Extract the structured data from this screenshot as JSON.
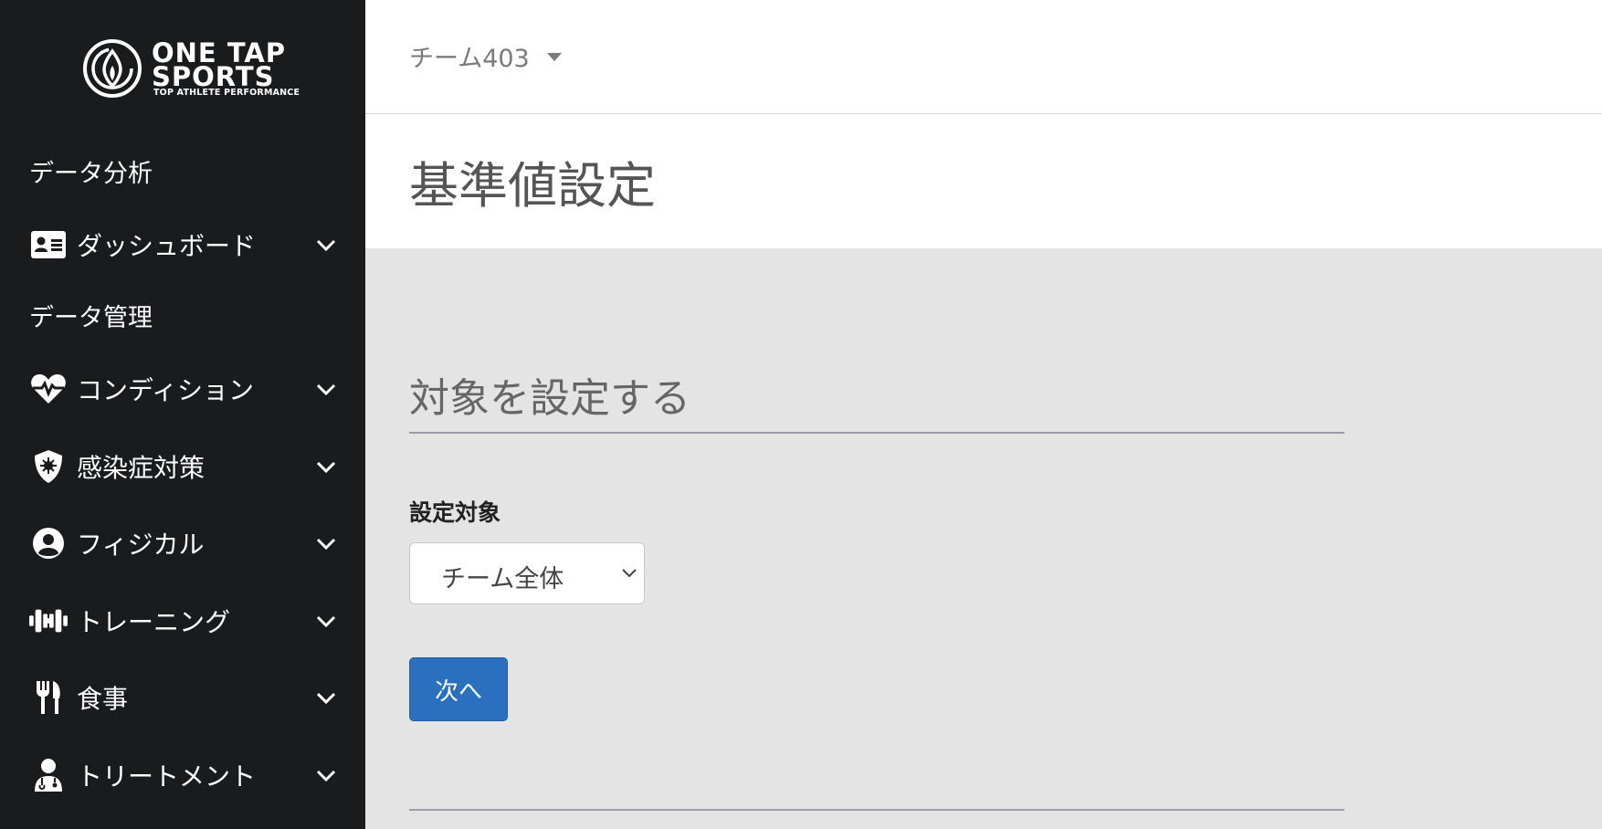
{
  "brand": {
    "line1": "ONE TAP",
    "line2": "SPORTS",
    "tagline": "TOP ATHLETE PERFORMANCE"
  },
  "sidebar": {
    "section_analysis": "データ分析",
    "section_management": "データ管理",
    "items": [
      {
        "label": "ダッシュボード",
        "icon": "id-card-icon"
      },
      {
        "label": "コンディション",
        "icon": "heartbeat-icon"
      },
      {
        "label": "感染症対策",
        "icon": "shield-virus-icon"
      },
      {
        "label": "フィジカル",
        "icon": "user-circle-icon"
      },
      {
        "label": "トレーニング",
        "icon": "dumbbell-icon"
      },
      {
        "label": "食事",
        "icon": "utensils-icon"
      },
      {
        "label": "トリートメント",
        "icon": "doctor-icon"
      }
    ]
  },
  "header": {
    "team": "チーム403"
  },
  "page": {
    "title": "基準値設定",
    "section_title": "対象を設定する",
    "field_label": "設定対象",
    "target_value": "チーム全体",
    "next_label": "次へ"
  },
  "colors": {
    "sidebar_bg": "#1a1b1d",
    "content_bg": "#e4e4e4",
    "primary_button": "#2b70be"
  }
}
